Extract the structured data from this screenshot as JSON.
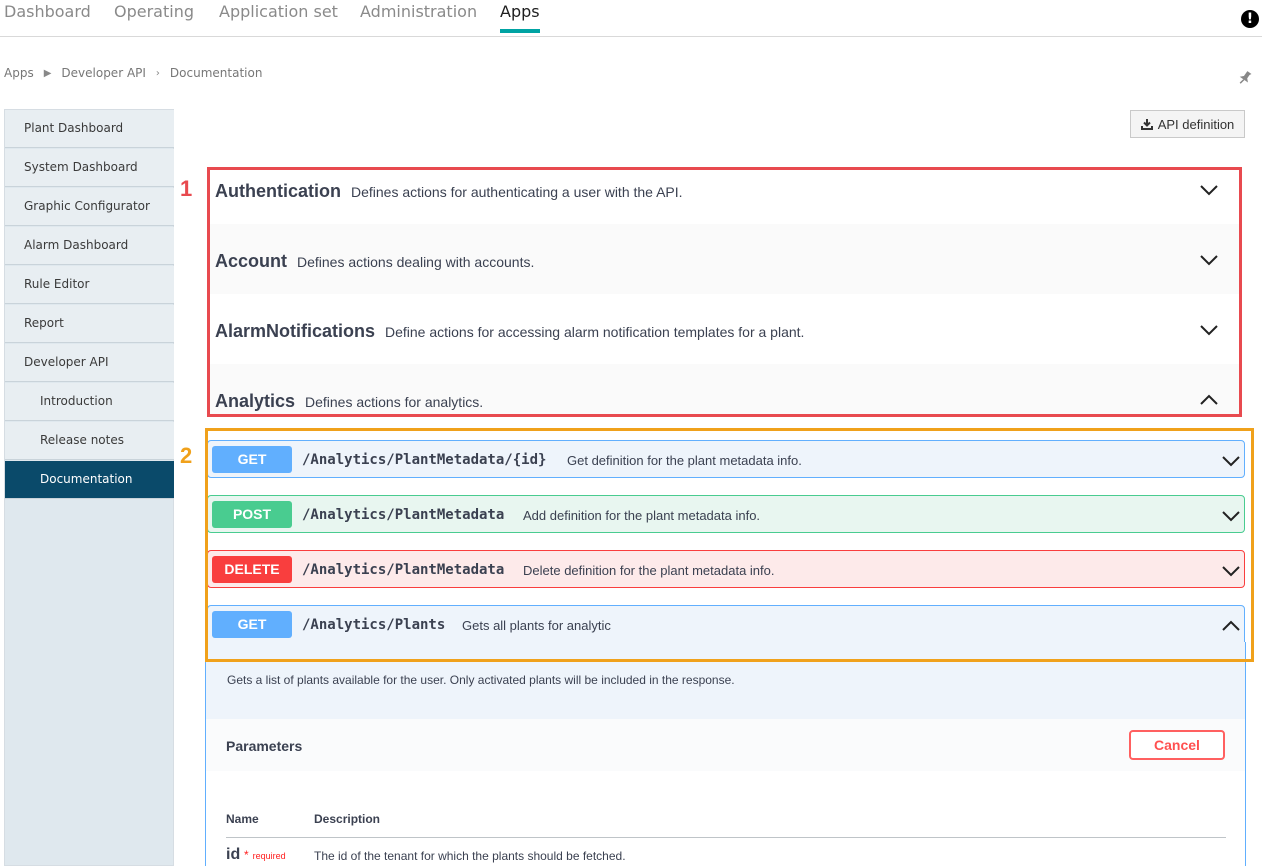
{
  "topnav": {
    "tabs": [
      "Dashboard",
      "Operating",
      "Application set",
      "Administration",
      "Apps"
    ],
    "active": "Apps"
  },
  "breadcrumb": [
    "Apps",
    "Developer API",
    "Documentation"
  ],
  "sidebar": {
    "items": [
      {
        "label": "Plant Dashboard"
      },
      {
        "label": "System Dashboard"
      },
      {
        "label": "Graphic Configurator"
      },
      {
        "label": "Alarm Dashboard"
      },
      {
        "label": "Rule Editor"
      },
      {
        "label": "Report"
      },
      {
        "label": "Developer API"
      },
      {
        "label": "Introduction"
      },
      {
        "label": "Release notes"
      },
      {
        "label": "Documentation"
      }
    ]
  },
  "toolbar": {
    "api_definition_label": "API definition"
  },
  "annotations": [
    "1",
    "2"
  ],
  "groups": [
    {
      "name": "Authentication",
      "desc": "Defines actions for authenticating a user with the API."
    },
    {
      "name": "Account",
      "desc": "Defines actions dealing with accounts."
    },
    {
      "name": "AlarmNotifications",
      "desc": "Define actions for accessing alarm notification templates for a plant."
    },
    {
      "name": "Analytics",
      "desc": "Defines actions for analytics."
    }
  ],
  "operations": [
    {
      "method": "GET",
      "path": "/Analytics/PlantMetadata/{id}",
      "summary": "Get definition for the plant metadata info."
    },
    {
      "method": "POST",
      "path": "/Analytics/PlantMetadata",
      "summary": "Add definition for the plant metadata info."
    },
    {
      "method": "DELETE",
      "path": "/Analytics/PlantMetadata",
      "summary": "Delete definition for the plant metadata info."
    },
    {
      "method": "GET",
      "path": "/Analytics/Plants",
      "summary": "Gets all plants for analytic"
    }
  ],
  "expanded_op": {
    "description": "Gets a list of plants available for the user. Only activated plants will be included in the response.",
    "parameters_title": "Parameters",
    "cancel_label": "Cancel",
    "columns": [
      "Name",
      "Description"
    ],
    "params": [
      {
        "name": "id",
        "required": "required",
        "required_mark": "*",
        "description": "The id of the tenant for which the plants should be fetched."
      }
    ]
  }
}
